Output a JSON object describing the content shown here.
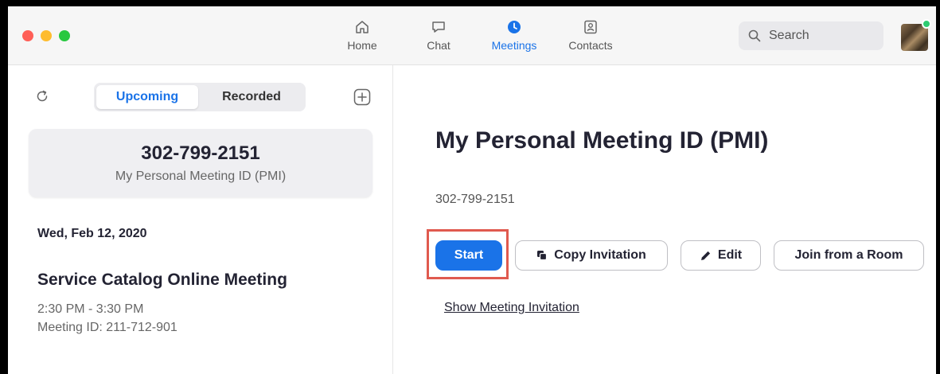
{
  "nav": {
    "tabs": [
      {
        "label": "Home",
        "icon": "home-icon"
      },
      {
        "label": "Chat",
        "icon": "chat-icon"
      },
      {
        "label": "Meetings",
        "icon": "clock-icon",
        "active": true
      },
      {
        "label": "Contacts",
        "icon": "contacts-icon"
      }
    ],
    "search_placeholder": "Search"
  },
  "sidebar": {
    "tabs": {
      "upcoming": "Upcoming",
      "recorded": "Recorded"
    },
    "pmi_card": {
      "number": "302-799-2151",
      "label": "My Personal Meeting ID (PMI)"
    },
    "date_header": "Wed, Feb 12, 2020",
    "meeting": {
      "title": "Service Catalog Online Meeting",
      "time": "2:30 PM - 3:30 PM",
      "meeting_id": "Meeting ID: 211-712-901"
    }
  },
  "detail": {
    "title": "My Personal Meeting ID (PMI)",
    "pmi": "302-799-2151",
    "buttons": {
      "start": "Start",
      "copy": "Copy Invitation",
      "edit": "Edit",
      "join": "Join from a Room"
    },
    "show_link": "Show Meeting Invitation"
  },
  "colors": {
    "accent": "#1a73e8",
    "highlight": "#e05a4f",
    "traffic_red": "#ff5f57",
    "traffic_yellow": "#febc2e",
    "traffic_green": "#28c840"
  }
}
